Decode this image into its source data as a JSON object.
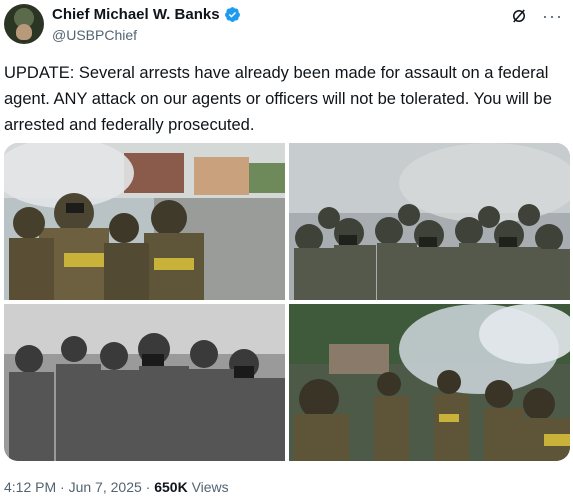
{
  "author": {
    "name": "Chief Michael W. Banks",
    "handle": "@USBPChief",
    "verified": true,
    "avatar_icon": "profile-photo"
  },
  "header_icons": [
    "grok-icon",
    "more-options-icon"
  ],
  "more_label": "···",
  "tweet": {
    "text": "UPDATE: Several arrests have already been made for assault on a federal agent. ANY attack on our agents or officers will not be tolerated. You will be arrested and federally prosecuted."
  },
  "media": [
    {
      "name": "photo-agents-street",
      "style": "color"
    },
    {
      "name": "photo-agents-gas-masks",
      "style": "desaturated"
    },
    {
      "name": "photo-agents-monochrome",
      "style": "black-and-white"
    },
    {
      "name": "photo-agents-smoke-trees",
      "style": "color"
    }
  ],
  "meta": {
    "time": "4:12 PM",
    "separator1": " · ",
    "date": "Jun 7, 2025",
    "separator2": " · ",
    "views_count": "650K",
    "views_label": " Views"
  },
  "colors": {
    "text_primary": "#0f1419",
    "text_secondary": "#536471",
    "verified_blue": "#1d9bf0"
  }
}
